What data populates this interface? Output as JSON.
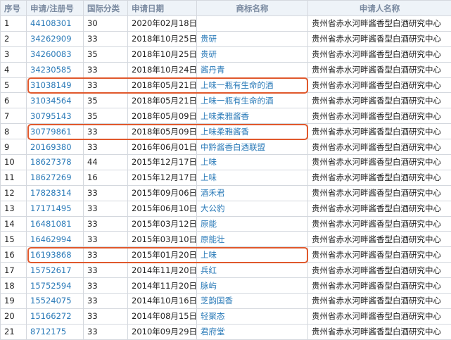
{
  "headers": [
    "序号",
    "申请/注册号",
    "国际分类",
    "申请日期",
    "商标名称",
    "申请人名称"
  ],
  "rows": [
    {
      "no": "1",
      "reg": "44108301",
      "cls": "30",
      "date": "2020年02月18日",
      "name": "",
      "applicant": "贵州省赤水河畔酱香型白酒研究中心",
      "highlight": false
    },
    {
      "no": "2",
      "reg": "34262909",
      "cls": "33",
      "date": "2018年10月25日",
      "name": "贵研",
      "applicant": "贵州省赤水河畔酱香型白酒研究中心",
      "highlight": false
    },
    {
      "no": "3",
      "reg": "34260083",
      "cls": "35",
      "date": "2018年10月25日",
      "name": "贵研",
      "applicant": "贵州省赤水河畔酱香型白酒研究中心",
      "highlight": false
    },
    {
      "no": "4",
      "reg": "34230585",
      "cls": "33",
      "date": "2018年10月24日",
      "name": "酱丹青",
      "applicant": "贵州省赤水河畔酱香型白酒研究中心",
      "highlight": false
    },
    {
      "no": "5",
      "reg": "31038149",
      "cls": "33",
      "date": "2018年05月21日",
      "name": "上味一瓶有生命的酒",
      "applicant": "贵州省赤水河畔酱香型白酒研究中心",
      "highlight": true
    },
    {
      "no": "6",
      "reg": "31034564",
      "cls": "35",
      "date": "2018年05月21日",
      "name": "上味一瓶有生命的酒",
      "applicant": "贵州省赤水河畔酱香型白酒研究中心",
      "highlight": false
    },
    {
      "no": "7",
      "reg": "30795143",
      "cls": "35",
      "date": "2018年05月09日",
      "name": "上味柔雅酱香",
      "applicant": "贵州省赤水河畔酱香型白酒研究中心",
      "highlight": false
    },
    {
      "no": "8",
      "reg": "30779861",
      "cls": "33",
      "date": "2018年05月09日",
      "name": "上味柔雅酱香",
      "applicant": "贵州省赤水河畔酱香型白酒研究中心",
      "highlight": true
    },
    {
      "no": "9",
      "reg": "20169380",
      "cls": "33",
      "date": "2016年06月01日",
      "name": "中黔酱香白酒联盟",
      "applicant": "贵州省赤水河畔酱香型白酒研究中心",
      "highlight": false
    },
    {
      "no": "10",
      "reg": "18627378",
      "cls": "44",
      "date": "2015年12月17日",
      "name": "上味",
      "applicant": "贵州省赤水河畔酱香型白酒研究中心",
      "highlight": false
    },
    {
      "no": "11",
      "reg": "18627269",
      "cls": "16",
      "date": "2015年12月17日",
      "name": "上味",
      "applicant": "贵州省赤水河畔酱香型白酒研究中心",
      "highlight": false
    },
    {
      "no": "12",
      "reg": "17828314",
      "cls": "33",
      "date": "2015年09月06日",
      "name": "酒禾君",
      "applicant": "贵州省赤水河畔酱香型白酒研究中心",
      "highlight": false
    },
    {
      "no": "13",
      "reg": "17171495",
      "cls": "33",
      "date": "2015年06月10日",
      "name": "大公豹",
      "applicant": "贵州省赤水河畔酱香型白酒研究中心",
      "highlight": false
    },
    {
      "no": "14",
      "reg": "16481081",
      "cls": "33",
      "date": "2015年03月12日",
      "name": "原能",
      "applicant": "贵州省赤水河畔酱香型白酒研究中心",
      "highlight": false
    },
    {
      "no": "15",
      "reg": "16462994",
      "cls": "33",
      "date": "2015年03月10日",
      "name": "原能壮",
      "applicant": "贵州省赤水河畔酱香型白酒研究中心",
      "highlight": false
    },
    {
      "no": "16",
      "reg": "16193868",
      "cls": "33",
      "date": "2015年01月20日",
      "name": "上味",
      "applicant": "贵州省赤水河畔酱香型白酒研究中心",
      "highlight": true
    },
    {
      "no": "17",
      "reg": "15752617",
      "cls": "33",
      "date": "2014年11月20日",
      "name": "兵红",
      "applicant": "贵州省赤水河畔酱香型白酒研究中心",
      "highlight": false
    },
    {
      "no": "18",
      "reg": "15752594",
      "cls": "33",
      "date": "2014年11月20日",
      "name": "脉屿",
      "applicant": "贵州省赤水河畔酱香型白酒研究中心",
      "highlight": false
    },
    {
      "no": "19",
      "reg": "15524075",
      "cls": "33",
      "date": "2014年10月16日",
      "name": "芝韵国香",
      "applicant": "贵州省赤水河畔酱香型白酒研究中心",
      "highlight": false
    },
    {
      "no": "20",
      "reg": "15166272",
      "cls": "33",
      "date": "2014年08月15日",
      "name": "轻聚态",
      "applicant": "贵州省赤水河畔酱香型白酒研究中心",
      "highlight": false
    },
    {
      "no": "21",
      "reg": "8712175",
      "cls": "33",
      "date": "2010年09月29日",
      "name": "君府堂",
      "applicant": "贵州省赤水河畔酱香型白酒研究中心",
      "highlight": false
    }
  ],
  "colors": {
    "link": "#2a7ab8",
    "highlight_border": "#e0582c",
    "header_bg": "#eef3f8",
    "grid": "#d4d8de"
  }
}
